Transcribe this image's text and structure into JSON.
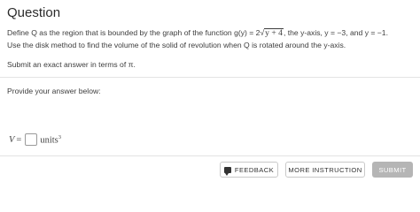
{
  "question": {
    "title": "Question",
    "line1_prefix": "Define Q as the region that is bounded by the graph of the function g(y) = 2",
    "line1_radicand": "y + 4",
    "line1_suffix": ", the y-axis, y = −3, and y = −1.",
    "line2": "Use the disk method to find the volume of the solid of revolution when Q is rotated around the y-axis.",
    "line3": "Submit an exact answer in terms of π."
  },
  "answer": {
    "prompt": "Provide your answer below:",
    "variable": "V",
    "equals": "=",
    "value": "",
    "units": "units",
    "units_exponent": "3"
  },
  "buttons": {
    "feedback": "FEEDBACK",
    "more_instruction": "MORE INSTRUCTION",
    "submit": "SUBMIT"
  }
}
